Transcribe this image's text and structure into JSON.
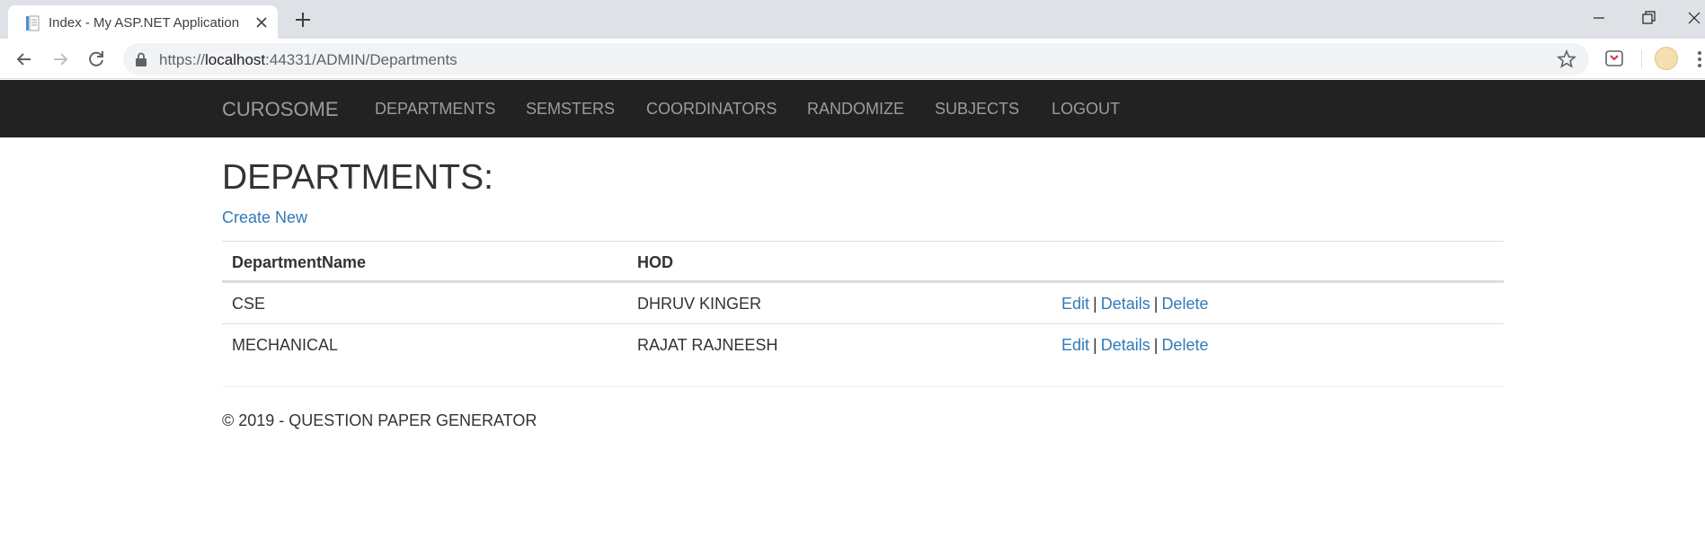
{
  "browser": {
    "tab_title": "Index - My ASP.NET Application",
    "url_scheme": "https://",
    "url_host": "localhost",
    "url_rest": ":44331/ADMIN/Departments",
    "icons": [
      "back-icon",
      "forward-icon",
      "reload-icon",
      "lock-icon",
      "star-icon",
      "pocket-icon",
      "menu-icon",
      "close-icon",
      "new-tab-icon",
      "minimize-icon",
      "restore-icon"
    ]
  },
  "navbar": {
    "brand": "CUROSOME",
    "links": [
      "DEPARTMENTS",
      "SEMSTERS",
      "COORDINATORS",
      "RANDOMIZE",
      "SUBJECTS",
      "LOGOUT"
    ],
    "background": "#222222",
    "link_color": "#9d9d9d"
  },
  "main": {
    "title": "DEPARTMENTS:",
    "create_link": "Create New",
    "table": {
      "headers": [
        "DepartmentName",
        "HOD"
      ],
      "rows": [
        {
          "name": "CSE",
          "hod": "DHRUV KINGER",
          "actions": [
            "Edit",
            "Details",
            "Delete"
          ]
        },
        {
          "name": "MECHANICAL",
          "hod": "RAJAT RAJNEESH",
          "actions": [
            "Edit",
            "Details",
            "Delete"
          ]
        }
      ],
      "separator": "|"
    },
    "link_color": "#337ab7"
  },
  "footer": {
    "text": "© 2019 - QUESTION PAPER GENERATOR"
  }
}
